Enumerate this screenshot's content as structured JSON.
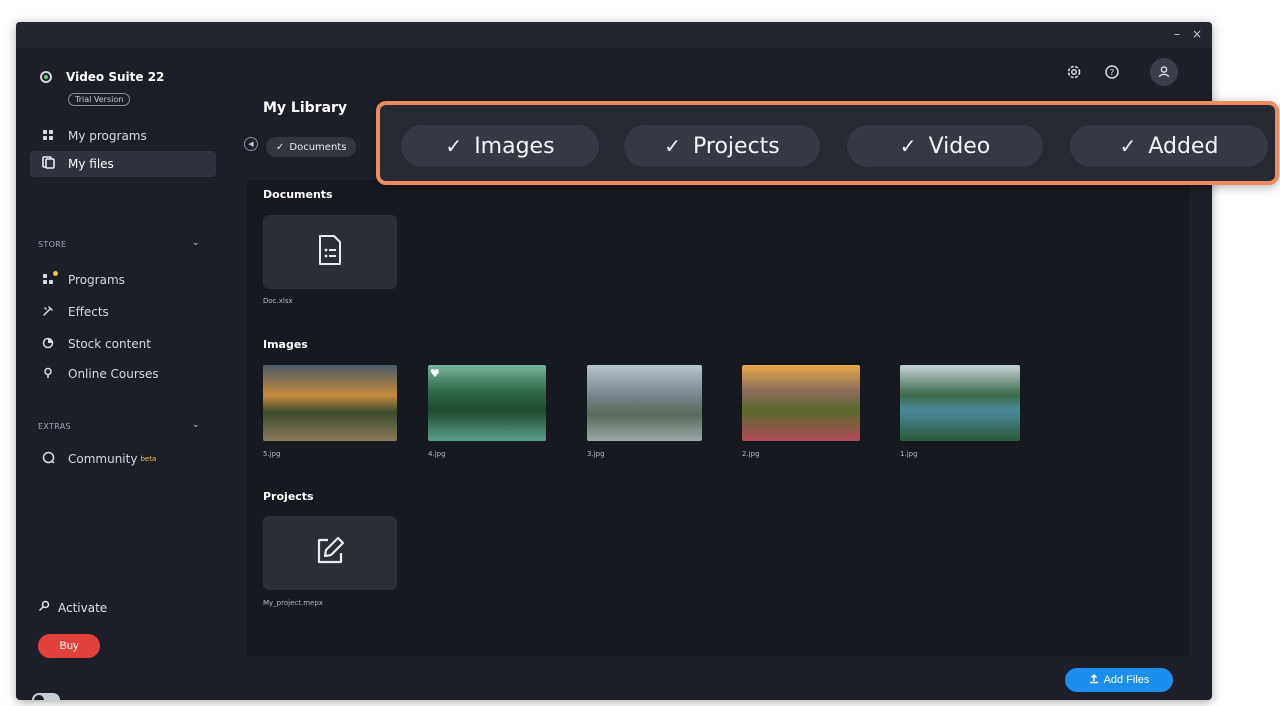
{
  "window": {
    "minimize": "–",
    "close": "×"
  },
  "brand": {
    "name": "Video Suite 22",
    "badge": "Trial Version"
  },
  "sidebar": {
    "items": [
      {
        "label": "My programs",
        "icon": "grid-icon"
      },
      {
        "label": "My files",
        "icon": "files-icon",
        "active": true
      }
    ],
    "store": {
      "label": "STORE",
      "items": [
        {
          "label": "Programs",
          "icon": "programs-icon"
        },
        {
          "label": "Effects",
          "icon": "effects-icon"
        },
        {
          "label": "Stock content",
          "icon": "stock-icon"
        },
        {
          "label": "Online Courses",
          "icon": "courses-icon"
        }
      ]
    },
    "extras": {
      "label": "EXTRAS",
      "items": [
        {
          "label": "Community",
          "badge": "beta",
          "icon": "community-icon"
        }
      ]
    },
    "activate": "Activate",
    "buy": "Buy"
  },
  "header": {
    "title": "My Library"
  },
  "filters": {
    "small": "Documents",
    "callout": [
      "Images",
      "Projects",
      "Video",
      "Added"
    ]
  },
  "groups": {
    "documents": {
      "title": "Documents",
      "files": [
        {
          "name": "Doc.xlsx"
        }
      ]
    },
    "images": {
      "title": "Images",
      "files": [
        {
          "name": "5.jpg"
        },
        {
          "name": "4.jpg",
          "favorite": true
        },
        {
          "name": "3.jpg"
        },
        {
          "name": "2.jpg"
        },
        {
          "name": "1.jpg"
        }
      ]
    },
    "projects": {
      "title": "Projects",
      "files": [
        {
          "name": "My_project.mepx"
        }
      ]
    }
  },
  "footer": {
    "add_files": "Add Files"
  },
  "colors": {
    "accent": "#1a8ff0",
    "buy": "#e2403c",
    "callout_border": "#f08a62",
    "background": "#1c1f27"
  }
}
